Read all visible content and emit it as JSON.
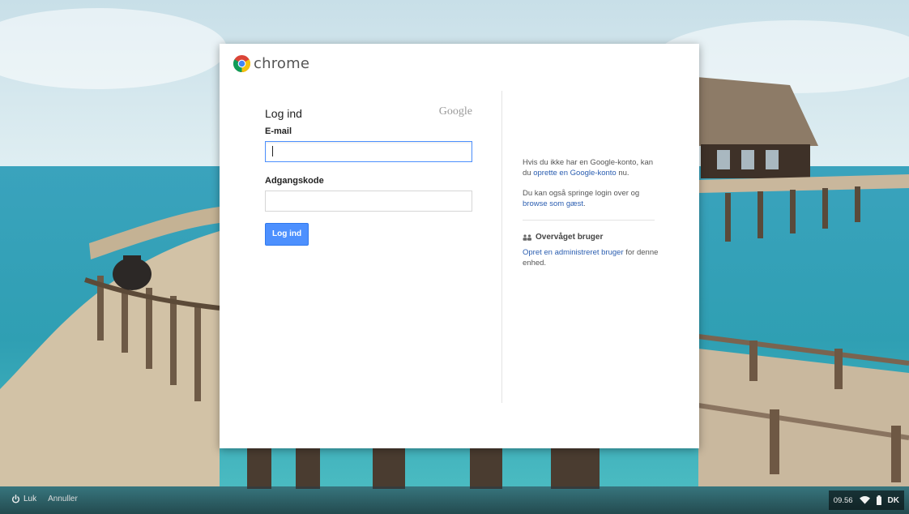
{
  "brand": {
    "name": "chrome",
    "logo_icon": "chrome-logo-icon"
  },
  "login": {
    "title": "Log ind",
    "google_wordmark": "Google",
    "email_label": "E-mail",
    "email_value": "",
    "password_label": "Adgangskode",
    "password_value": "",
    "submit_label": "Log ind"
  },
  "info": {
    "p1_prefix": "Hvis du ikke har en Google-konto, kan du ",
    "p1_link": "oprette en Google-konto",
    "p1_suffix": " nu.",
    "p2_prefix": "Du kan også springe login over og ",
    "p2_link": "browse som gæst",
    "p2_suffix": ".",
    "supervised_title": "Overvåget bruger",
    "supervised_link": "Opret en administreret bruger",
    "supervised_suffix": " for denne enhed."
  },
  "taskbar": {
    "power_label": "Luk",
    "cancel_label": "Annuller",
    "time": "09.56",
    "language": "DK"
  },
  "colors": {
    "accent": "#4d90fe",
    "link": "#2a5db0"
  }
}
